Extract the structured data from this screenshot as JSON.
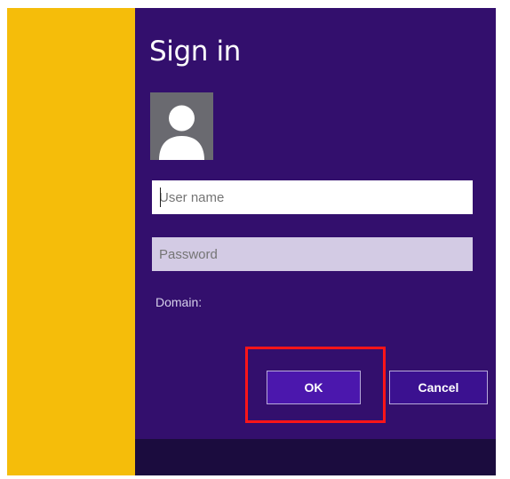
{
  "dialog": {
    "title": "Sign in",
    "username_placeholder": "User name",
    "password_placeholder": "Password",
    "domain_label": "Domain:",
    "ok_label": "OK",
    "cancel_label": "Cancel"
  },
  "colors": {
    "accent_panel": "#f5bd0a",
    "dialog_background": "#330f6d",
    "highlight": "#ff1518"
  },
  "icons": {
    "avatar": "user-avatar-icon"
  }
}
